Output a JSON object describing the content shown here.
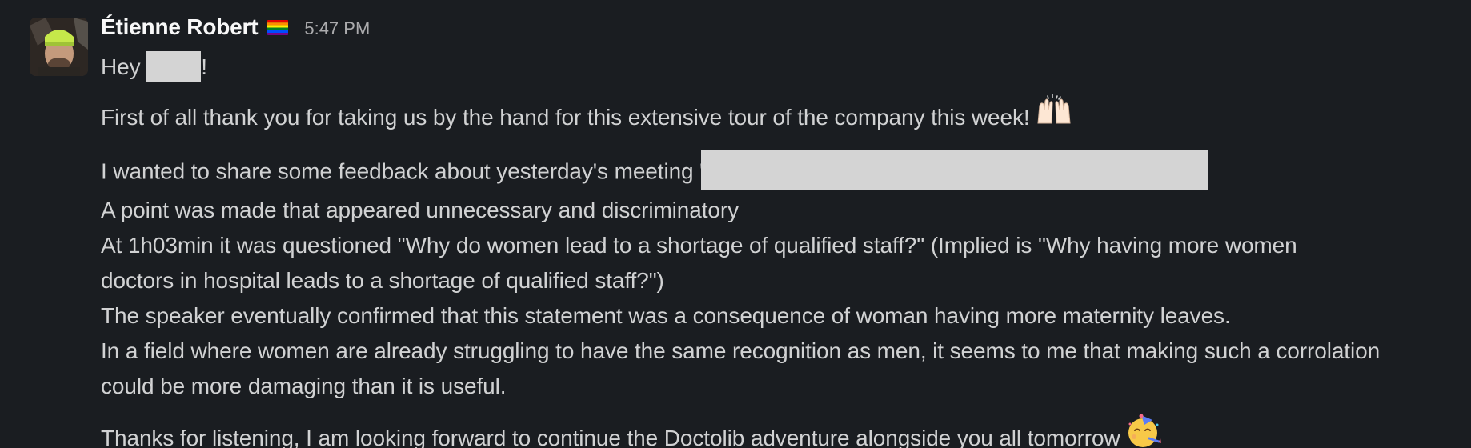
{
  "message": {
    "sender": "Étienne Robert",
    "status_icon": "rainbow-flag-icon",
    "timestamp": "5:47 PM",
    "greeting_start": "Hey ",
    "greeting_end": "!",
    "line_thanks": "First of all thank you for taking us by the hand for this extensive tour of the company this week!",
    "thanks_emoji": "raising-hands-emoji",
    "line_feedback": "I wanted to share some feedback about yesterday's meeting \"",
    "line_point": "A point was made that appeared unnecessary and discriminatory",
    "line_question_1": "At 1h03min it was questioned \"Why do women lead to a shortage of qualified staff?\" (Implied is \"Why having more women",
    "line_question_2": "doctors in hospital leads to a shortage of qualified staff?\")",
    "line_speaker": "The speaker eventually confirmed that this statement was a consequence of woman having more maternity leaves.",
    "line_field_1": "In a field where women are already struggling to have the same recognition as men, it seems to me that making such a corrolation",
    "line_field_2": "could be more damaging than it is useful.",
    "line_closing": "Thanks for listening, I am looking forward to continue the Doctolib adventure alongside you all tomorrow",
    "closing_emoji": "partying-face-emoji"
  },
  "colors": {
    "background": "#1a1d21",
    "text": "#d1d2d3",
    "sender": "#f8f8f8",
    "timestamp": "#ababad",
    "redaction": "#d4d4d4"
  }
}
